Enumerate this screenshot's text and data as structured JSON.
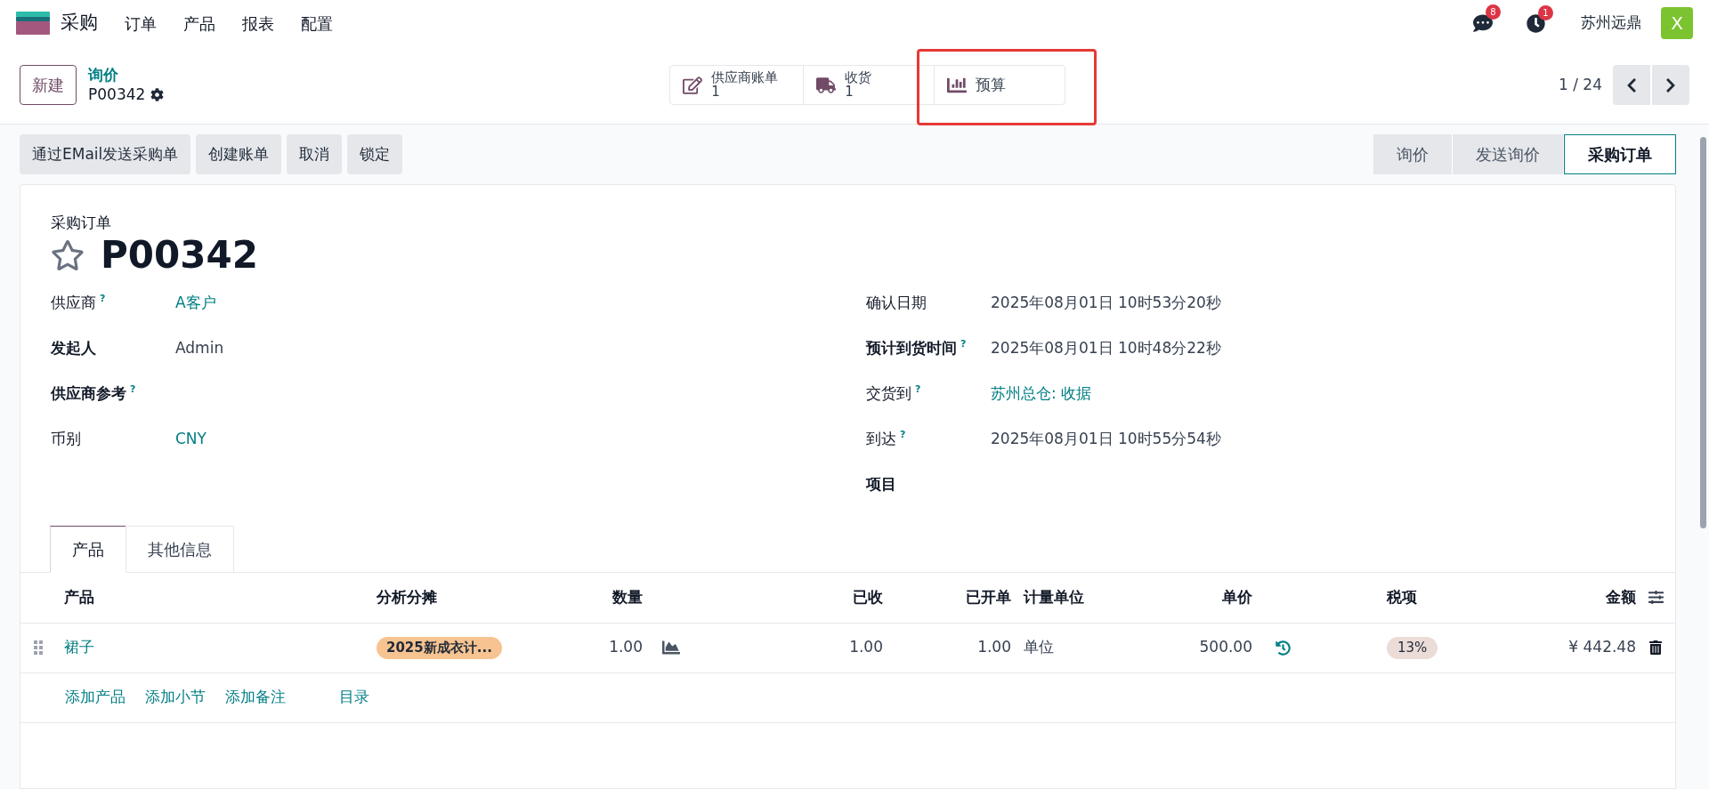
{
  "navbar": {
    "app": "采购",
    "menus": [
      "订单",
      "产品",
      "报表",
      "配置"
    ],
    "messages_badge": "8",
    "activities_badge": "1",
    "company": "苏州远鼎",
    "avatar": "X"
  },
  "control_panel": {
    "new_button": "新建",
    "breadcrumb": "询价",
    "record": "P00342",
    "pager": "1 / 24",
    "smart_buttons": [
      {
        "kind": "bill",
        "label": "供应商账单",
        "value": "1",
        "highlighted": false
      },
      {
        "kind": "truck",
        "label": "收货",
        "value": "1",
        "highlighted": false
      },
      {
        "kind": "chart",
        "label": "预算",
        "highlighted": true
      }
    ]
  },
  "actions": [
    "通过EMail发送采购单",
    "创建账单",
    "取消",
    "锁定"
  ],
  "status_bar": [
    {
      "label": "询价",
      "selected": false
    },
    {
      "label": "发送询价",
      "selected": false
    },
    {
      "label": "采购订单",
      "selected": true
    }
  ],
  "form": {
    "subtitle": "采购订单",
    "title": "P00342",
    "starred": false,
    "left_fields": [
      {
        "label": "供应商",
        "help": "?",
        "required": false,
        "value": "A客户",
        "link": true
      },
      {
        "label": "发起人",
        "required": true,
        "value": "Admin",
        "link": false
      },
      {
        "label": "供应商参考",
        "help": "?",
        "required": true
      },
      {
        "label": "币别",
        "required": false,
        "value": "CNY",
        "link": true
      }
    ],
    "right_fields": [
      {
        "label": "确认日期",
        "required": false,
        "value": "2025年08月01日 10时53分20秒",
        "link": false
      },
      {
        "label": "预计到货时间",
        "help": "?",
        "required": true,
        "value": "2025年08月01日 10时48分22秒",
        "link": false
      },
      {
        "label": "交货到",
        "help": "?",
        "required": false,
        "value": "苏州总仓: 收据",
        "link": true
      },
      {
        "label": "到达",
        "help": "?",
        "required": false,
        "value": "2025年08月01日 10时55分54秒",
        "link": false
      },
      {
        "label": "项目",
        "required": true
      }
    ]
  },
  "tabs": [
    {
      "label": "产品",
      "selected": true
    },
    {
      "label": "其他信息",
      "selected": false
    }
  ],
  "table": {
    "columns": [
      "产品",
      "分析分摊",
      "数量",
      "已收",
      "已开单",
      "计量单位",
      "单价",
      "税项",
      "金额"
    ],
    "rows": [
      {
        "product": "裙子",
        "analytic": "2025新成衣计...",
        "quantity": "1.00",
        "received": "1.00",
        "billed": "1.00",
        "uom": "单位",
        "price": "500.00",
        "tax": "13%",
        "amount": "¥ 442.48"
      }
    ],
    "add_links": [
      "添加产品",
      "添加小节",
      "添加备注",
      "目录"
    ]
  }
}
